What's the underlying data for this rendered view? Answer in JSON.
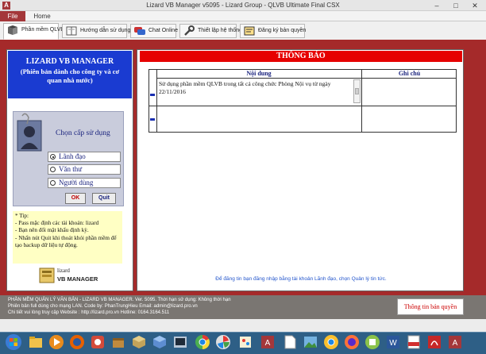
{
  "window": {
    "title": "Lizard VB Manager v5095 - Lizard Group - QLVB Ultimate Final CSX",
    "app_icon": "A",
    "minimize_icon": "minimize-icon",
    "restore_icon": "restore-icon",
    "close_icon": "close-icon"
  },
  "ribbon": {
    "file": "File",
    "home": "Home"
  },
  "tabs": [
    {
      "label": "Phần mềm QLVB",
      "icon": "toolbox-icon"
    },
    {
      "label": "Hướng dẫn sử dụng",
      "icon": "book-icon"
    },
    {
      "label": "Chat Online",
      "icon": "chat-icon"
    },
    {
      "label": "Thiết lập hệ thống",
      "icon": "wrench-icon"
    },
    {
      "label": "Đăng ký bản quyền",
      "icon": "license-icon"
    }
  ],
  "left": {
    "title": "LIZARD VB MANAGER",
    "subtitle": "(Phiên bản dành cho công ty và cơ quan nhà nước)",
    "login_title": "Chọn cấp sử dụng",
    "roles": [
      {
        "label": "Lãnh đạo",
        "selected": true
      },
      {
        "label": "Văn thư",
        "selected": false
      },
      {
        "label": "Người dùng",
        "selected": false
      }
    ],
    "ok": "OK",
    "quit": "Quit",
    "tips": [
      "* Tip:",
      "- Pass mặc định các tài khoản: lizard",
      "- Bạn nên đổi mật khẩu định kỳ.",
      "- Nhấn nút Quit khi thoát khỏi phần mềm để tạo backup dữ liệu tự động."
    ],
    "logo_line1": "lizard",
    "logo_line2": "VB MANAGER"
  },
  "right": {
    "header": "THÔNG BÁO",
    "columns": [
      "Nội dung",
      "Ghi chú"
    ],
    "rows": [
      {
        "content": "Sử dụng phần mềm QLVB trong tất cả công chức Phòng Nội vụ từ ngày 22/11/2016",
        "note": ""
      },
      {
        "content": "",
        "note": ""
      }
    ],
    "hint": "Để đăng tin bạn đăng nhập bằng tài khoản Lãnh đạo, chọn Quản lý tin tức."
  },
  "status": {
    "line1": "PHẦN MỀM QUẢN LÝ VĂN BẢN - LIZARD VB MANAGER. Ver. 5095. Thời hạn sử dụng: Không thời hạn",
    "line2": "Phiên bản full dùng cho mạng LAN. Code by: PhanTrungHieu          Email: admin@lizard.pro.vn",
    "line3": "Chi tiết vui lòng truy cập Website : http://lizard.pro.vn      Hotline:  0164.3164.511",
    "license_button": "Thông tin bản quyền"
  },
  "taskbar": {
    "icons": [
      "start-icon",
      "explorer-icon",
      "media-icon",
      "firefox-icon",
      "app-icon",
      "box-icon",
      "cube-icon",
      "virtualbox-icon",
      "chrome-icon",
      "paint-icon",
      "file-icon",
      "image-icon",
      "word-icon",
      "pdf-icon",
      "access-icon"
    ]
  },
  "colors": {
    "frame": "#a52a2a",
    "header_blue": "#1a3bd1",
    "notice_red": "#e60000",
    "tip_yellow": "#ffffc4",
    "taskbar": "#2e5f86"
  }
}
